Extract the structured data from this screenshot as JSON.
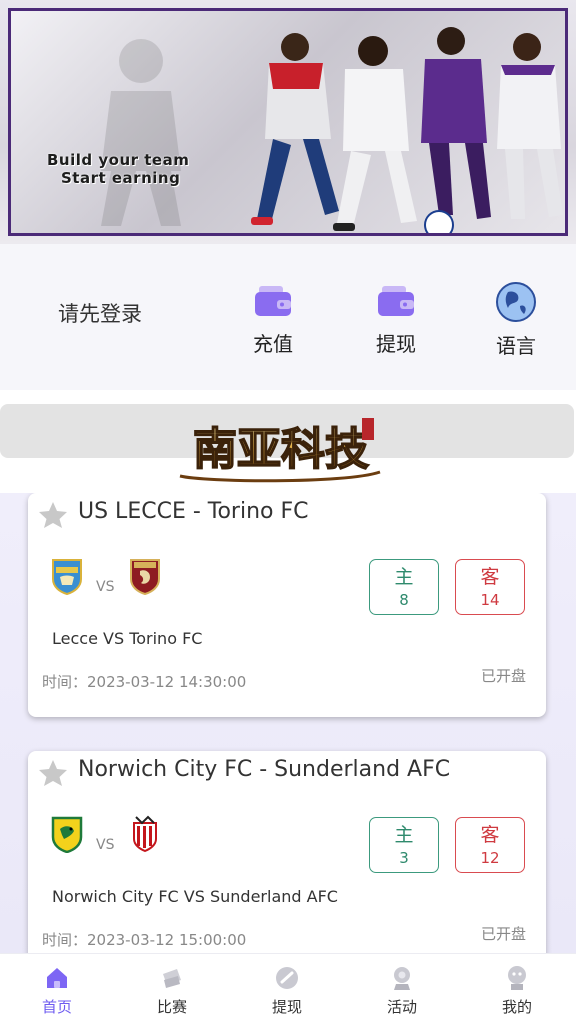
{
  "banner": {
    "line1": "Build your team",
    "line2": "Start earning"
  },
  "quick_actions": {
    "login_hint": "请先登录",
    "items": [
      {
        "label": "充值",
        "icon": "wallet-icon"
      },
      {
        "label": "提现",
        "icon": "wallet-icon"
      },
      {
        "label": "语言",
        "icon": "globe-icon"
      }
    ]
  },
  "logo": {
    "text": "南亚科技"
  },
  "matches": [
    {
      "title": "US LECCE - Torino FC",
      "home_crest": "lecce-crest-icon",
      "away_crest": "torino-crest-icon",
      "vs": "VS",
      "home_label": "主",
      "home_odds": "8",
      "away_label": "客",
      "away_odds": "14",
      "fixture": "Lecce VS Torino FC",
      "time": "时间：2023-03-12 14:30:00",
      "status": "已开盘"
    },
    {
      "title": "Norwich City FC - Sunderland AFC",
      "home_crest": "norwich-crest-icon",
      "away_crest": "sunderland-crest-icon",
      "vs": "VS",
      "home_label": "主",
      "home_odds": "3",
      "away_label": "客",
      "away_odds": "12",
      "fixture": "Norwich City FC VS Sunderland AFC",
      "time": "时间：2023-03-12 15:00:00",
      "status": "已开盘"
    }
  ],
  "tabbar": {
    "items": [
      {
        "label": "首页",
        "icon": "home-icon",
        "active": true
      },
      {
        "label": "比赛",
        "icon": "match-icon",
        "active": false
      },
      {
        "label": "提现",
        "icon": "withdraw-icon",
        "active": false
      },
      {
        "label": "活动",
        "icon": "activity-icon",
        "active": false
      },
      {
        "label": "我的",
        "icon": "profile-icon",
        "active": false
      }
    ]
  },
  "colors": {
    "accent": "#6f5cf0",
    "home_odds": "#2f8a6d",
    "away_odds": "#cf3a40",
    "banner_border": "#4b2a78"
  }
}
